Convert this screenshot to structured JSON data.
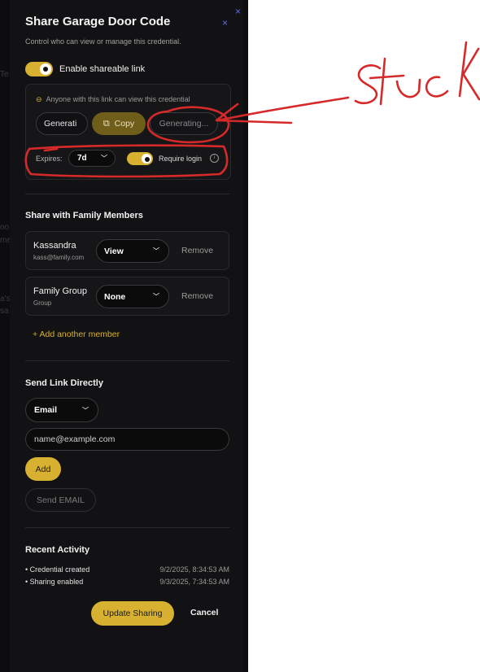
{
  "background": {
    "fragments": [
      "Te",
      "oo",
      "me",
      "a's",
      "sa"
    ]
  },
  "dialog": {
    "title": "Share Garage Door Code",
    "subtitle": "Control who can view or manage this credential.",
    "close_icon": "×"
  },
  "shareable_link": {
    "toggle_label": "Enable shareable link",
    "enabled": true,
    "hint": "Anyone with this link can view this credential",
    "link_value": "Generati",
    "copy_label": "Copy",
    "status_label": "Generating...",
    "expires_label": "Expires:",
    "expires_value": "7d",
    "require_login_label": "Require login",
    "require_login": true
  },
  "family": {
    "section_title": "Share with Family Members",
    "members": [
      {
        "name": "Kassandra",
        "sub": "kass@family.com",
        "permission": "View",
        "remove_label": "Remove"
      },
      {
        "name": "Family Group",
        "sub": "Group",
        "permission": "None",
        "remove_label": "Remove"
      }
    ],
    "add_label": "+ Add another member"
  },
  "send_direct": {
    "section_title": "Send Link Directly",
    "method": "Email",
    "email_placeholder": "name@example.com",
    "add_label": "Add",
    "send_label": "Send EMAIL"
  },
  "activity": {
    "section_title": "Recent Activity",
    "items": [
      {
        "text": "• Credential created",
        "time": "9/2/2025, 8:34:53 AM"
      },
      {
        "text": "• Sharing enabled",
        "time": "9/3/2025, 7:34:53 AM"
      }
    ]
  },
  "footer": {
    "update_label": "Update Sharing",
    "cancel_label": "Cancel"
  },
  "annotation": {
    "text": "Stuc K",
    "color": "#d62a2a"
  },
  "colors": {
    "accent": "#d7b12f",
    "panel": "#121214",
    "close": "#5b6cf0"
  }
}
